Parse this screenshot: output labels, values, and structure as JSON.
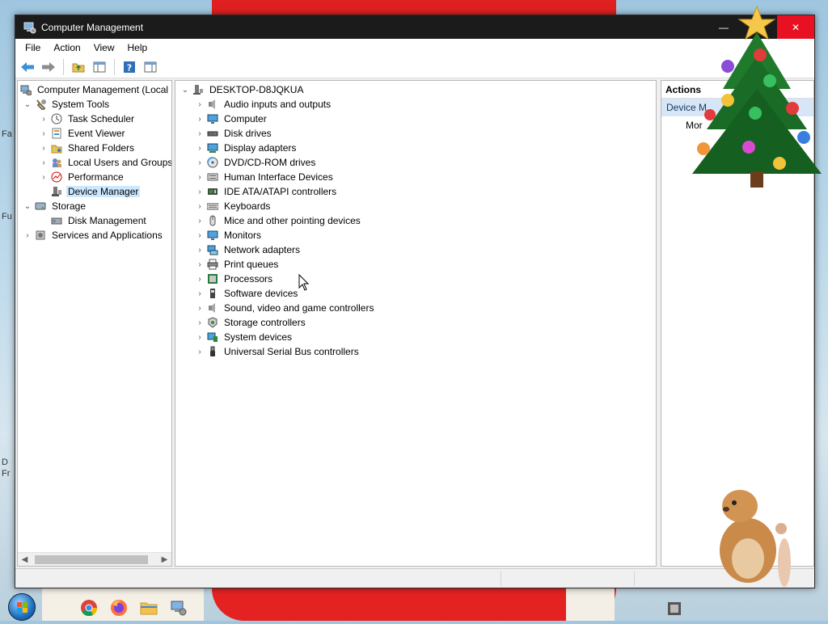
{
  "window": {
    "title": "Computer Management",
    "min_glyph": "—",
    "max_glyph": "☐",
    "close_glyph": "✕"
  },
  "menu": [
    "File",
    "Action",
    "View",
    "Help"
  ],
  "toolbar_icons": [
    "back-arrow-icon",
    "forward-arrow-icon",
    "up-folder-icon",
    "show-hide-console-tree-icon",
    "help-icon",
    "show-hide-action-pane-icon"
  ],
  "left_tree": [
    {
      "label": "Computer Management (Local",
      "level": 0,
      "chevron": "",
      "icon": "computer-management-icon"
    },
    {
      "label": "System Tools",
      "level": 1,
      "chevron": "v",
      "icon": "system-tools-icon"
    },
    {
      "label": "Task Scheduler",
      "level": 2,
      "chevron": ">",
      "icon": "clock-icon"
    },
    {
      "label": "Event Viewer",
      "level": 2,
      "chevron": ">",
      "icon": "event-viewer-icon"
    },
    {
      "label": "Shared Folders",
      "level": 2,
      "chevron": ">",
      "icon": "shared-folders-icon"
    },
    {
      "label": "Local Users and Groups",
      "level": 2,
      "chevron": ">",
      "icon": "users-icon"
    },
    {
      "label": "Performance",
      "level": 2,
      "chevron": ">",
      "icon": "performance-icon"
    },
    {
      "label": "Device Manager",
      "level": 2,
      "chevron": "",
      "icon": "device-manager-icon",
      "selected": true
    },
    {
      "label": "Storage",
      "level": 1,
      "chevron": "v",
      "icon": "storage-icon"
    },
    {
      "label": "Disk Management",
      "level": 2,
      "chevron": "",
      "icon": "disk-management-icon"
    },
    {
      "label": "Services and Applications",
      "level": 1,
      "chevron": ">",
      "icon": "services-icon"
    }
  ],
  "device_tree": {
    "root": "DESKTOP-D8JQKUA",
    "categories": [
      {
        "label": "Audio inputs and outputs",
        "icon": "speaker-icon"
      },
      {
        "label": "Computer",
        "icon": "monitor-icon"
      },
      {
        "label": "Disk drives",
        "icon": "disk-drive-icon"
      },
      {
        "label": "Display adapters",
        "icon": "display-adapter-icon"
      },
      {
        "label": "DVD/CD-ROM drives",
        "icon": "dvd-icon"
      },
      {
        "label": "Human Interface Devices",
        "icon": "hid-icon"
      },
      {
        "label": "IDE ATA/ATAPI controllers",
        "icon": "ide-controller-icon"
      },
      {
        "label": "Keyboards",
        "icon": "keyboard-icon"
      },
      {
        "label": "Mice and other pointing devices",
        "icon": "mouse-icon"
      },
      {
        "label": "Monitors",
        "icon": "monitor-icon"
      },
      {
        "label": "Network adapters",
        "icon": "network-icon"
      },
      {
        "label": "Print queues",
        "icon": "printer-icon"
      },
      {
        "label": "Processors",
        "icon": "processor-icon"
      },
      {
        "label": "Software devices",
        "icon": "software-device-icon"
      },
      {
        "label": "Sound, video and game controllers",
        "icon": "speaker-icon"
      },
      {
        "label": "Storage controllers",
        "icon": "storage-controller-icon"
      },
      {
        "label": "System devices",
        "icon": "system-device-icon"
      },
      {
        "label": "Universal Serial Bus controllers",
        "icon": "usb-icon"
      }
    ]
  },
  "actions": {
    "header": "Actions",
    "section": "Device M",
    "item": "Mor"
  },
  "desktop": {
    "left_texts": [
      "Fa",
      "Fu",
      "D",
      "Fr"
    ]
  },
  "colors": {
    "titlebar": "#1b1b1b",
    "close": "#e81123",
    "selection": "#cce8ff",
    "actions_section": "#d6e6f7"
  }
}
